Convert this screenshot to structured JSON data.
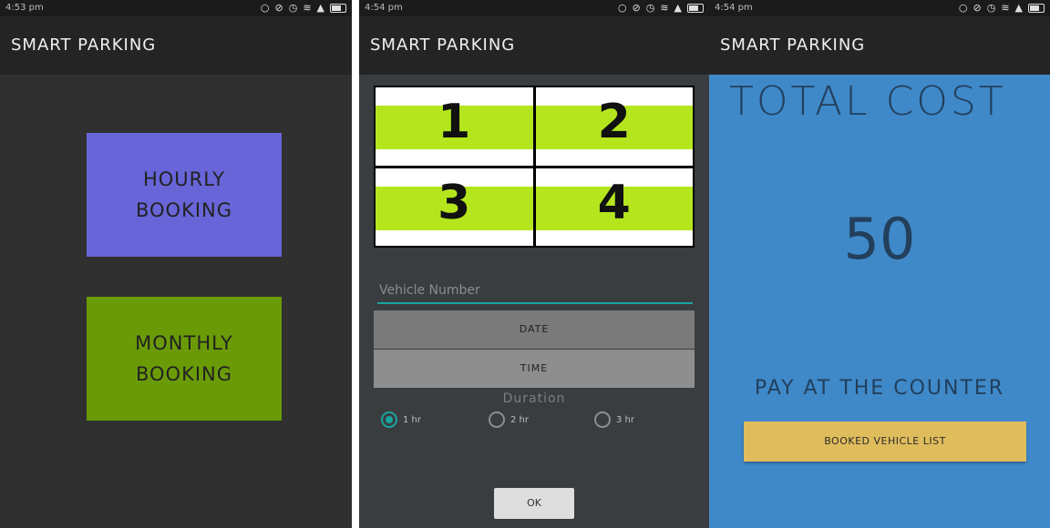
{
  "screens": [
    {
      "status_time": "4:53 pm",
      "app_title": "SMART PARKING",
      "hourly_label": "HOURLY\nBOOKING",
      "monthly_label": "MONTHLY\nBOOKING"
    },
    {
      "status_time": "4:54 pm",
      "app_title": "SMART PARKING",
      "slots": [
        "1",
        "2",
        "3",
        "4"
      ],
      "vehicle_placeholder": "Vehicle Number",
      "date_label": "DATE",
      "time_label": "TIME",
      "duration_label": "Duration",
      "durations": [
        {
          "label": "1 hr",
          "checked": true
        },
        {
          "label": "2 hr",
          "checked": false
        },
        {
          "label": "3 hr",
          "checked": false
        }
      ],
      "ok_label": "OK"
    },
    {
      "status_time": "4:54 pm",
      "app_title": "SMART PARKING",
      "total_cost_label": "TOTAL COST",
      "total_cost_value": "50",
      "pay_label": "PAY AT THE COUNTER",
      "booked_list_label": "BOOKED VEHICLE LIST"
    }
  ],
  "status_icons": [
    "alarm-icon",
    "silent-icon",
    "clock-icon",
    "wifi-icon",
    "signal-icon",
    "battery-icon"
  ],
  "colors": {
    "hourly": "#6765d8",
    "monthly": "#6a9b07",
    "slot_band": "#b5e61d",
    "accent": "#19a59f",
    "summary_bg": "#3f89c9",
    "booked_btn": "#e0bd5c"
  }
}
